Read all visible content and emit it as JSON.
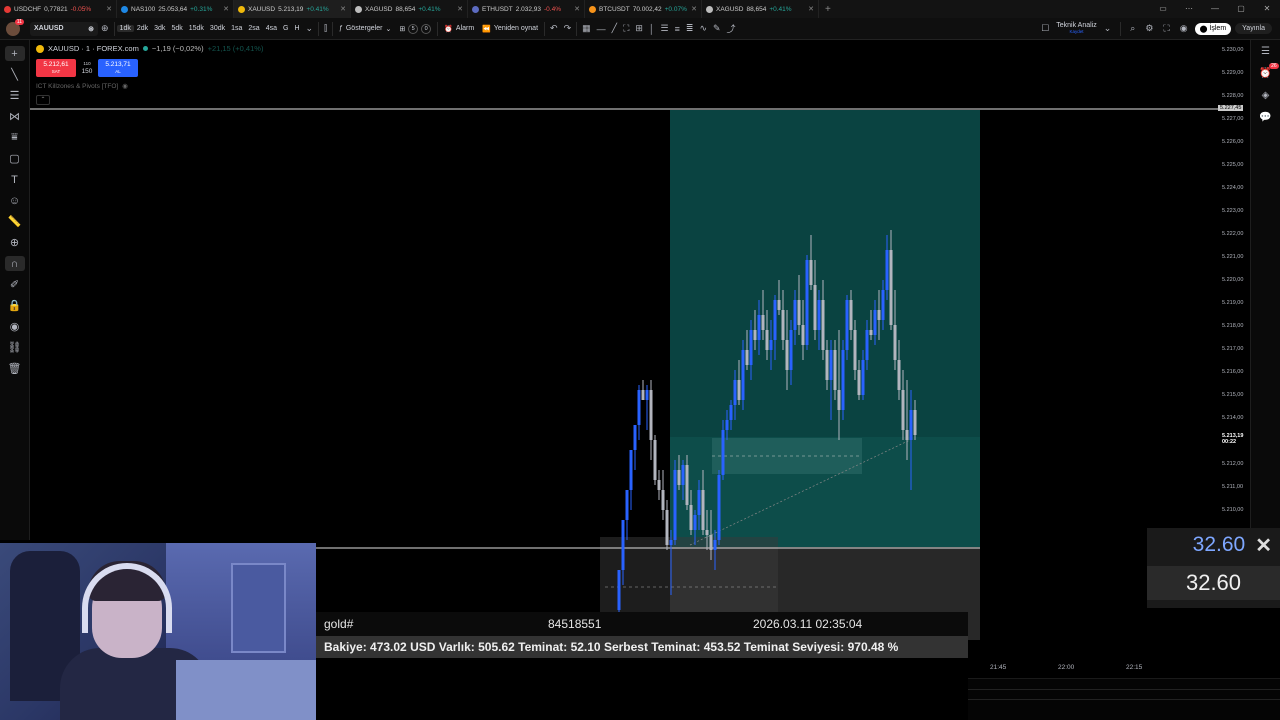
{
  "browser_tabs": [
    {
      "symbol": "USDCHF",
      "price": "0,77821",
      "change": "-0.05%",
      "dir": "neg",
      "color": "#e53935"
    },
    {
      "symbol": "NAS100",
      "price": "25.053,64",
      "change": "+0.31%",
      "dir": "pos",
      "color": "#1e88e5"
    },
    {
      "symbol": "XAUUSD",
      "price": "5.213,19",
      "change": "+0.41%",
      "dir": "pos",
      "color": "#f0b90b",
      "active": true
    },
    {
      "symbol": "XAGUSD",
      "price": "88,654",
      "change": "+0.41%",
      "dir": "pos",
      "color": "#bdbdbd"
    },
    {
      "symbol": "ETHUSDT",
      "price": "2.032,93",
      "change": "-0.4%",
      "dir": "neg",
      "color": "#5c6bc0"
    },
    {
      "symbol": "BTCUSDT",
      "price": "70.002,42",
      "change": "+0.07%",
      "dir": "pos",
      "color": "#f7931a"
    },
    {
      "symbol": "XAGUSD",
      "price": "88,654",
      "change": "+0.41%",
      "dir": "pos",
      "color": "#bdbdbd"
    }
  ],
  "toolbar": {
    "notif_count": "11",
    "symbol": "XAUUSD",
    "timeframes": [
      "1dk",
      "2dk",
      "3dk",
      "5dk",
      "15dk",
      "30dk",
      "1sa",
      "2sa",
      "4sa",
      "G",
      "H"
    ],
    "active_timeframe": "1dk",
    "indicators_label": "Göstergeler",
    "layout_count_1": "5",
    "layout_count_2": "0",
    "alarm_label": "Alarm",
    "replay_label": "Yeniden oynat",
    "tech_analysis_label": "Teknik Analiz",
    "tech_analysis_sub": "Kaydet",
    "trade_label": "İşlem",
    "publish_label": "Yayınla"
  },
  "legend": {
    "title": "XAUUSD · 1 · FOREX.com",
    "change": "−1,19 (−0,02%)",
    "change2": "+21,15 (+0,41%)",
    "sell_price": "5.212,61",
    "sell_label": "SAT",
    "buy_price": "5.213,71",
    "buy_label": "AL",
    "spread_top": "110",
    "spread": "150",
    "indicator_name": "ICT Killzones & Pivots [TFO]"
  },
  "right_sidebar": {
    "alert_count": "26"
  },
  "price_scale": {
    "labels": [
      "5.230,00",
      "5.229,00",
      "5.228,00",
      "5.227,00",
      "5.226,00",
      "5.225,00",
      "5.224,00",
      "5.223,00",
      "5.222,00",
      "5.221,00",
      "5.220,00",
      "5.219,00",
      "5.218,00",
      "5.217,00",
      "5.216,00",
      "5.215,00",
      "5.214,00",
      "5.212,00",
      "5.211,00",
      "5.210,00"
    ],
    "highlight_label": "5.227,45",
    "current_price": "5.213,19",
    "countdown": "00:22"
  },
  "account": {
    "symbol": "gold#",
    "ticket": "84518551",
    "time": "2026.03.11 02:35:04",
    "summary": "Bakiye: 473.02 USD  Varlık: 505.62  Teminat: 52.10  Serbest Teminat: 453.52  Teminat Seviyesi: 970.48 %"
  },
  "lot_widget": {
    "top_value": "32.60",
    "value": "32.60"
  },
  "time_axis": [
    "21:45",
    "22:00",
    "22:15"
  ],
  "colors": {
    "bull": "#2962ff",
    "bear": "#b2b5be",
    "target_zone": "#0b4a48",
    "stop_zone": "#2a2a2a",
    "sell": "#f23645",
    "buy": "#2962ff"
  }
}
